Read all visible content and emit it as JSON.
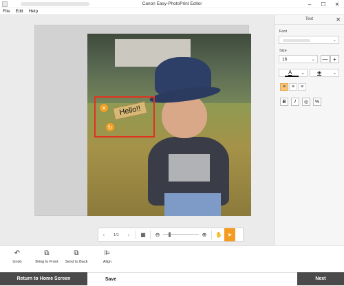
{
  "window": {
    "title": "Canon Easy-PhotoPrint Editor",
    "minimize_icon": "minimize-icon",
    "maximize_icon": "maximize-icon",
    "close_icon": "close-icon"
  },
  "menu": {
    "file": "File",
    "edit": "Edit",
    "help": "Help"
  },
  "canvas": {
    "text_item": {
      "text": "Hello!!"
    }
  },
  "zoombar": {
    "page": "1/1"
  },
  "panel": {
    "title": "Text",
    "font_label": "Font",
    "size_label": "Size",
    "size_value": "16",
    "minus": "—",
    "plus": "+",
    "font_color_glyph": "A",
    "style_bold": "B",
    "style_italic": "I",
    "style_outline": "◎",
    "style_other": "%"
  },
  "actions": {
    "undo": "Undo",
    "bring_front": "Bring to Front",
    "send_back": "Send to Back",
    "align": "Align"
  },
  "footer": {
    "home": "Return to Home Screen",
    "save": "Save",
    "next": "Next"
  },
  "colors": {
    "accent": "#f49c22",
    "selection": "#e0321e",
    "dark_button": "#4a4a4a"
  }
}
